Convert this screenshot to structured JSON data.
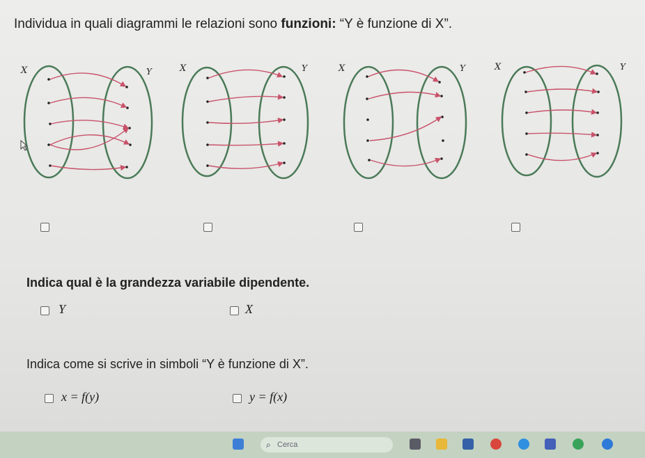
{
  "q1": {
    "prefix": "Individua in quali diagrammi le relazioni sono ",
    "bold": "funzioni:",
    "suffix": " “Y è funzione di X”."
  },
  "diagrams": [
    {
      "x_label": "X",
      "y_label": "Y"
    },
    {
      "x_label": "X",
      "y_label": "Y"
    },
    {
      "x_label": "X",
      "y_label": "Y"
    },
    {
      "x_label": "X",
      "y_label": "Y"
    }
  ],
  "q2": {
    "text": "Indica qual è la grandezza variabile dipendente.",
    "options": [
      "Y",
      "X"
    ]
  },
  "q3": {
    "text": "Indica come si scrive in simboli “Y è funzione di X”.",
    "options": [
      "x = f(y)",
      "y = f(x)"
    ]
  },
  "taskbar": {
    "search_placeholder": "Cerca"
  },
  "colors": {
    "arrow": "#c8536a",
    "oval": "#4a7a58"
  }
}
